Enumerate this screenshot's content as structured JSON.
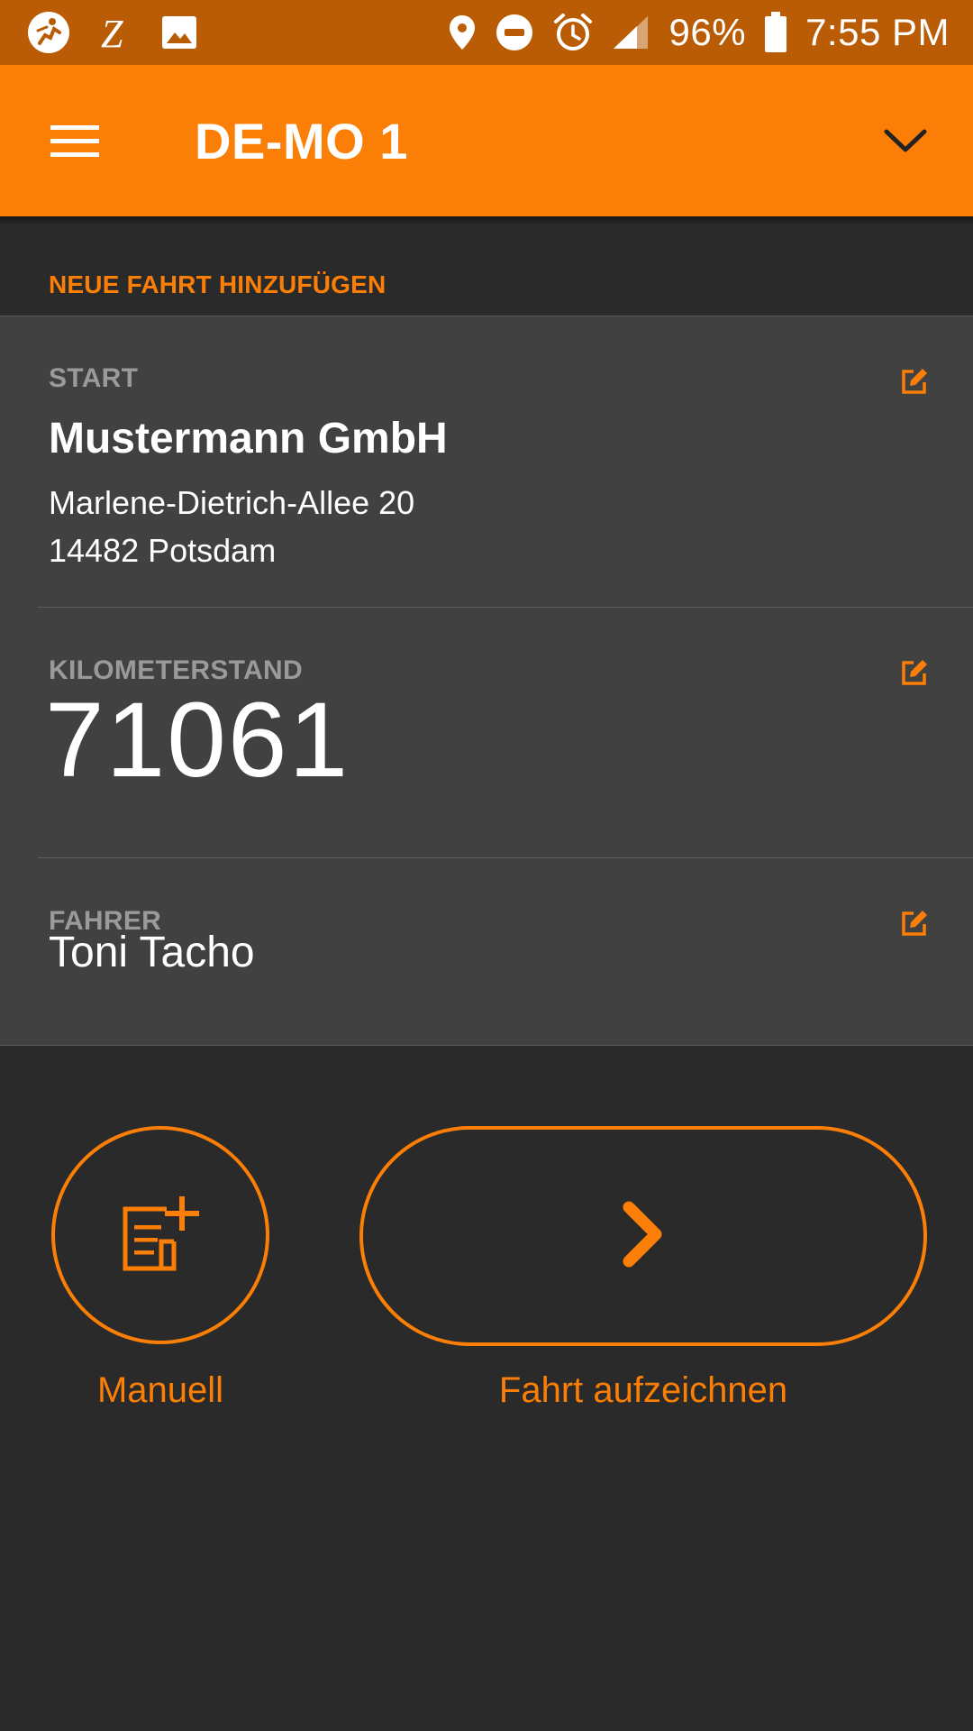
{
  "status_bar": {
    "battery": "96%",
    "time": "7:55 PM",
    "left_icons": [
      "activity-app-icon",
      "z-app-icon",
      "gallery-icon"
    ],
    "right_icons": [
      "location-icon",
      "do-not-disturb-icon",
      "alarm-icon",
      "signal-icon",
      "battery-icon"
    ]
  },
  "app_bar": {
    "title": "DE-MO 1",
    "menu_icon": "hamburger-menu-icon",
    "dropdown_icon": "chevron-down-icon"
  },
  "section": {
    "title": "NEUE FAHRT HINZUFÜGEN"
  },
  "start": {
    "label": "START",
    "company": "Mustermann GmbH",
    "street": "Marlene-Dietrich-Allee 20",
    "city": "14482 Potsdam",
    "edit_icon": "edit-icon"
  },
  "mileage": {
    "label": "KILOMETERSTAND",
    "value": "71061",
    "edit_icon": "edit-icon"
  },
  "driver": {
    "label": "FAHRER",
    "name": "Toni Tacho",
    "edit_icon": "edit-icon"
  },
  "actions": {
    "manual_label": "Manuell",
    "manual_icon": "add-note-icon",
    "record_label": "Fahrt aufzeichnen",
    "record_icon": "chevron-right-icon"
  },
  "colors": {
    "accent": "#fb7f06",
    "status_bar": "#b95c05",
    "background": "#2a2a2a",
    "card": "#414141"
  }
}
